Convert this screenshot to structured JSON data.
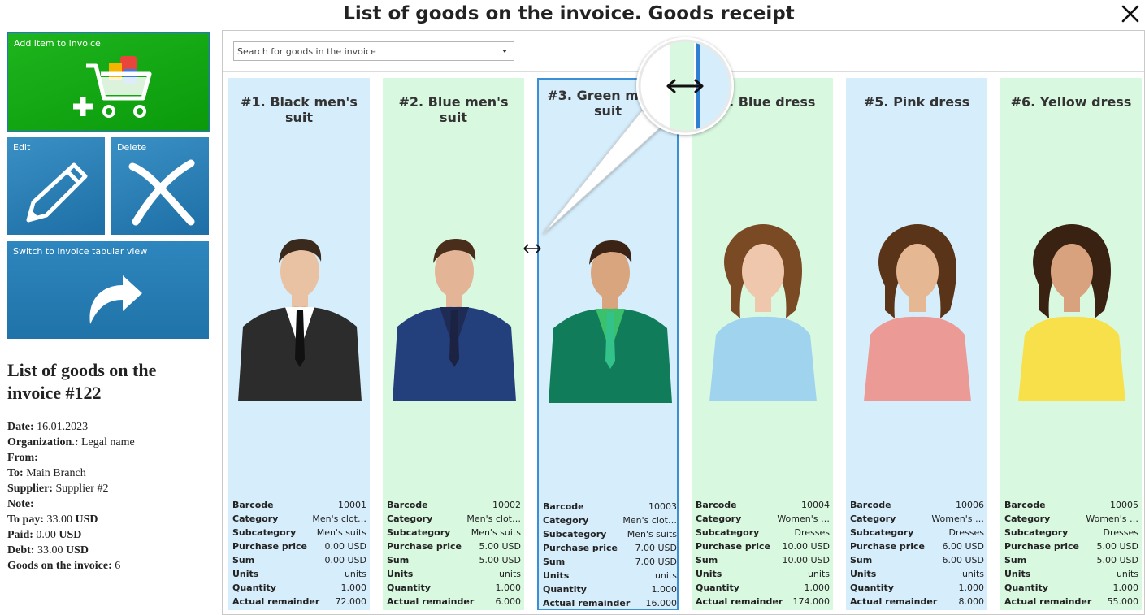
{
  "window": {
    "title": "List of goods on the invoice. Goods receipt"
  },
  "toolbar": {
    "add_label": "Add item to invoice",
    "edit_label": "Edit",
    "delete_label": "Delete",
    "switch_label": "Switch to invoice tabular view"
  },
  "invoice": {
    "heading": "List of goods on the invoice #122",
    "date_label": "Date:",
    "date": "16.01.2023",
    "org_label": "Organization.:",
    "org": "Legal name",
    "from_label": "From:",
    "from": "",
    "to_label": "To:",
    "to": "Main Branch",
    "supplier_label": "Supplier:",
    "supplier": "Supplier #2",
    "note_label": "Note:",
    "note": "",
    "topay_label": "To pay:",
    "topay": "33.00",
    "topay_cur": "USD",
    "paid_label": "Paid:",
    "paid": "0.00",
    "paid_cur": "USD",
    "debt_label": "Debt:",
    "debt": "33.00",
    "debt_cur": "USD",
    "goods_label": "Goods on the invoice:",
    "goods": "6"
  },
  "search": {
    "placeholder": "Search for goods in the invoice"
  },
  "field_labels": {
    "barcode": "Barcode",
    "category": "Category",
    "subcategory": "Subcategory",
    "price": "Purchase price",
    "sum": "Sum",
    "units": "Units",
    "quantity": "Quantity",
    "remainder": "Actual remainder"
  },
  "cards": [
    {
      "name": "#1. Black men's suit",
      "barcode": "10001",
      "category": "Men's clot…",
      "subcategory": "Men's suits",
      "price": "0.00 USD",
      "sum": "0.00 USD",
      "units": "units",
      "quantity": "1.000",
      "remainder": "72.000",
      "color": "blue"
    },
    {
      "name": "#2. Blue men's suit",
      "barcode": "10002",
      "category": "Men's clot…",
      "subcategory": "Men's suits",
      "price": "5.00 USD",
      "sum": "5.00 USD",
      "units": "units",
      "quantity": "1.000",
      "remainder": "6.000",
      "color": "green"
    },
    {
      "name": "#3. Green men's suit",
      "barcode": "10003",
      "category": "Men's clot…",
      "subcategory": "Men's suits",
      "price": "7.00 USD",
      "sum": "7.00 USD",
      "units": "units",
      "quantity": "1.000",
      "remainder": "16.000",
      "color": "blue"
    },
    {
      "name": "#4. Blue dress",
      "barcode": "10004",
      "category": "Women's …",
      "subcategory": "Dresses",
      "price": "10.00 USD",
      "sum": "10.00 USD",
      "units": "units",
      "quantity": "1.000",
      "remainder": "174.000",
      "color": "green"
    },
    {
      "name": "#5. Pink dress",
      "barcode": "10006",
      "category": "Women's …",
      "subcategory": "Dresses",
      "price": "6.00 USD",
      "sum": "6.00 USD",
      "units": "units",
      "quantity": "1.000",
      "remainder": "8.000",
      "color": "blue"
    },
    {
      "name": "#6. Yellow dress",
      "barcode": "10005",
      "category": "Women's …",
      "subcategory": "Dresses",
      "price": "5.00 USD",
      "sum": "5.00 USD",
      "units": "units",
      "quantity": "1.000",
      "remainder": "55.000",
      "color": "green"
    }
  ]
}
